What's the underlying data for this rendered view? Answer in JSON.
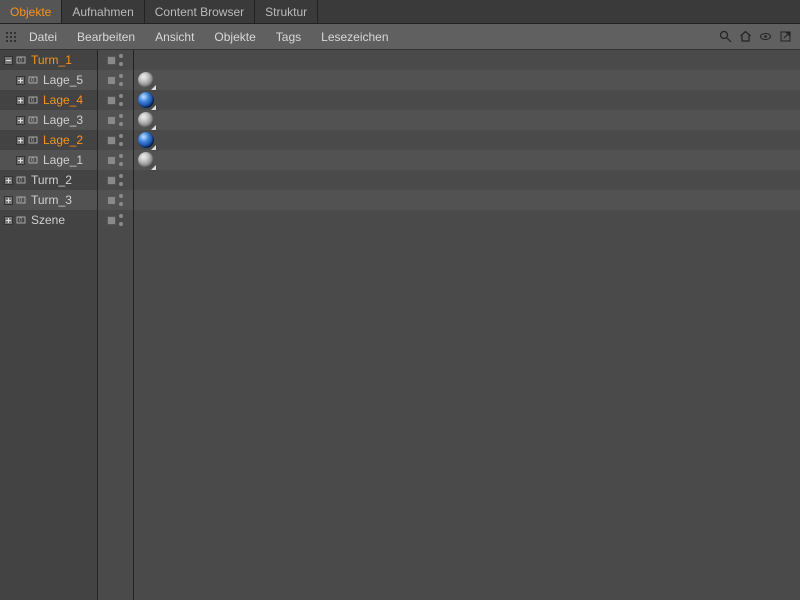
{
  "tabs": [
    {
      "label": "Objekte",
      "active": true
    },
    {
      "label": "Aufnahmen",
      "active": false
    },
    {
      "label": "Content Browser",
      "active": false
    },
    {
      "label": "Struktur",
      "active": false
    }
  ],
  "menu": {
    "items": [
      "Datei",
      "Bearbeiten",
      "Ansicht",
      "Objekte",
      "Tags",
      "Lesezeichen"
    ]
  },
  "tree": [
    {
      "name": "Turm_1",
      "level": 0,
      "expanded": true,
      "selected": true,
      "tag": null,
      "alt": false
    },
    {
      "name": "Lage_5",
      "level": 1,
      "expanded": false,
      "selected": false,
      "tag": "gray",
      "alt": true
    },
    {
      "name": "Lage_4",
      "level": 1,
      "expanded": false,
      "selected": true,
      "tag": "blue",
      "alt": false
    },
    {
      "name": "Lage_3",
      "level": 1,
      "expanded": false,
      "selected": false,
      "tag": "gray",
      "alt": true
    },
    {
      "name": "Lage_2",
      "level": 1,
      "expanded": false,
      "selected": true,
      "tag": "blue",
      "alt": false
    },
    {
      "name": "Lage_1",
      "level": 1,
      "expanded": false,
      "selected": false,
      "tag": "gray",
      "alt": true
    },
    {
      "name": "Turm_2",
      "level": 0,
      "expanded": false,
      "selected": false,
      "tag": null,
      "alt": false
    },
    {
      "name": "Turm_3",
      "level": 0,
      "expanded": false,
      "selected": false,
      "tag": null,
      "alt": true
    },
    {
      "name": "Szene",
      "level": 0,
      "expanded": false,
      "selected": false,
      "tag": null,
      "alt": false
    }
  ]
}
